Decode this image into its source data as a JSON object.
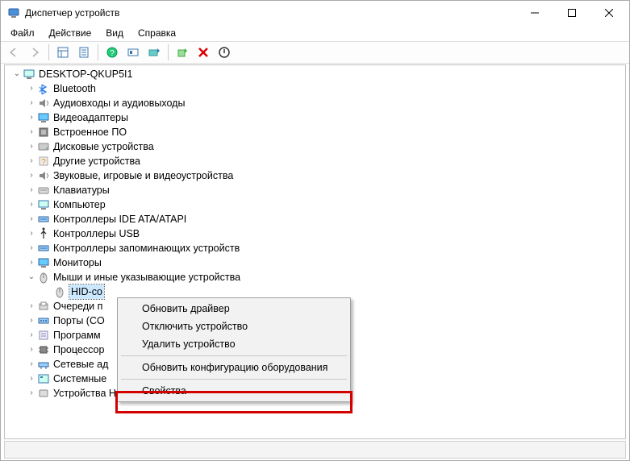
{
  "window": {
    "title": "Диспетчер устройств"
  },
  "menu": {
    "file": "Файл",
    "action": "Действие",
    "view": "Вид",
    "help": "Справка"
  },
  "tree": {
    "root": "DESKTOP-QKUP5I1",
    "categories": [
      "Bluetooth",
      "Аудиовходы и аудиовыходы",
      "Видеоадаптеры",
      "Встроенное ПО",
      "Дисковые устройства",
      "Другие устройства",
      "Звуковые, игровые и видеоустройства",
      "Клавиатуры",
      "Компьютер",
      "Контроллеры IDE ATA/ATAPI",
      "Контроллеры USB",
      "Контроллеры запоминающих устройств",
      "Мониторы",
      "Мыши и иные указывающие устройства",
      "Очереди п",
      "Порты (CO",
      "Программ",
      "Процессор",
      "Сетевые ад",
      "Системные",
      "Устройства HID (Human Interface Devices)"
    ],
    "selected_device": "HID-co"
  },
  "context_menu": {
    "update_driver": "Обновить драйвер",
    "disable": "Отключить устройство",
    "uninstall": "Удалить устройство",
    "scan": "Обновить конфигурацию оборудования",
    "properties": "Свойства"
  }
}
